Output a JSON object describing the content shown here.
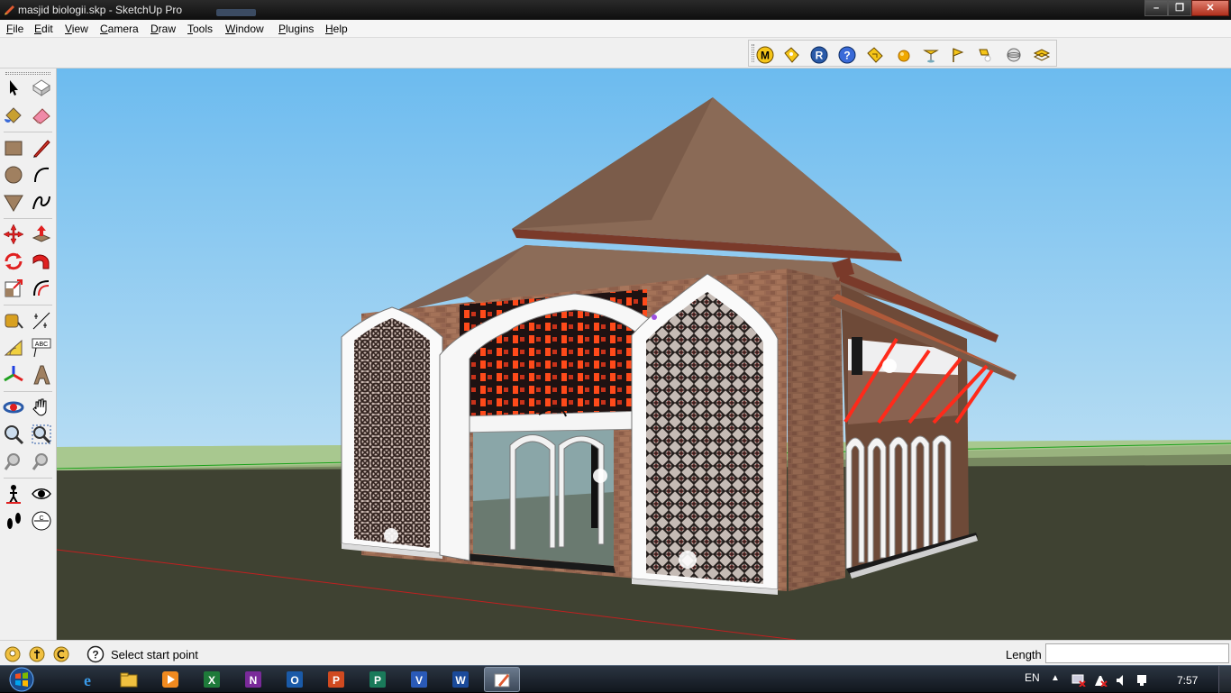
{
  "window": {
    "title": "masjid biologii.skp - SketchUp Pro",
    "minimize": "–",
    "maximize": "❐",
    "close": "✕"
  },
  "menu": [
    "File",
    "Edit",
    "View",
    "Camera",
    "Draw",
    "Tools",
    "Window",
    "Plugins",
    "Help"
  ],
  "top_toolbar": {
    "icons": [
      "m-badge-icon",
      "component-tag-icon",
      "r-badge-icon",
      "help-badge-icon",
      "ruby-console-icon",
      "orange-sphere-icon",
      "pin-icon",
      "flag-icon",
      "light-icon",
      "sphere-icon",
      "section-icon"
    ],
    "m_label": "M",
    "r_label": "R",
    "help_label": "?"
  },
  "left_toolbar": {
    "tools": [
      "select",
      "make-component",
      "paint-bucket",
      "eraser",
      "rectangle",
      "line",
      "circle",
      "arc",
      "polygon",
      "freehand",
      "move",
      "push-pull",
      "rotate",
      "follow-me",
      "scale",
      "offset",
      "tape-measure",
      "dimension",
      "protractor",
      "text",
      "axes",
      "3d-text",
      "orbit",
      "pan",
      "zoom",
      "zoom-window",
      "previous-view",
      "next-view",
      "position-camera",
      "look-around",
      "walk",
      "section-plane"
    ],
    "text_label": "ABC",
    "section_label": "C"
  },
  "statusbar": {
    "hint": "Select start point",
    "vcb_label": "Length",
    "vcb_value": ""
  },
  "taskbar": {
    "apps": [
      "internet-explorer",
      "file-explorer",
      "media-player",
      "excel",
      "onenote",
      "outlook",
      "powerpoint",
      "publisher",
      "visio",
      "word",
      "sketchup"
    ],
    "language": "EN",
    "time": "7:57"
  },
  "colors": {
    "sky": "#76c3ee",
    "ground": "#3f4232",
    "horizon": "#a5c58b",
    "roof": "#8a6a56",
    "brick": "#9a6a52",
    "accent_red": "#ff2a1a"
  }
}
